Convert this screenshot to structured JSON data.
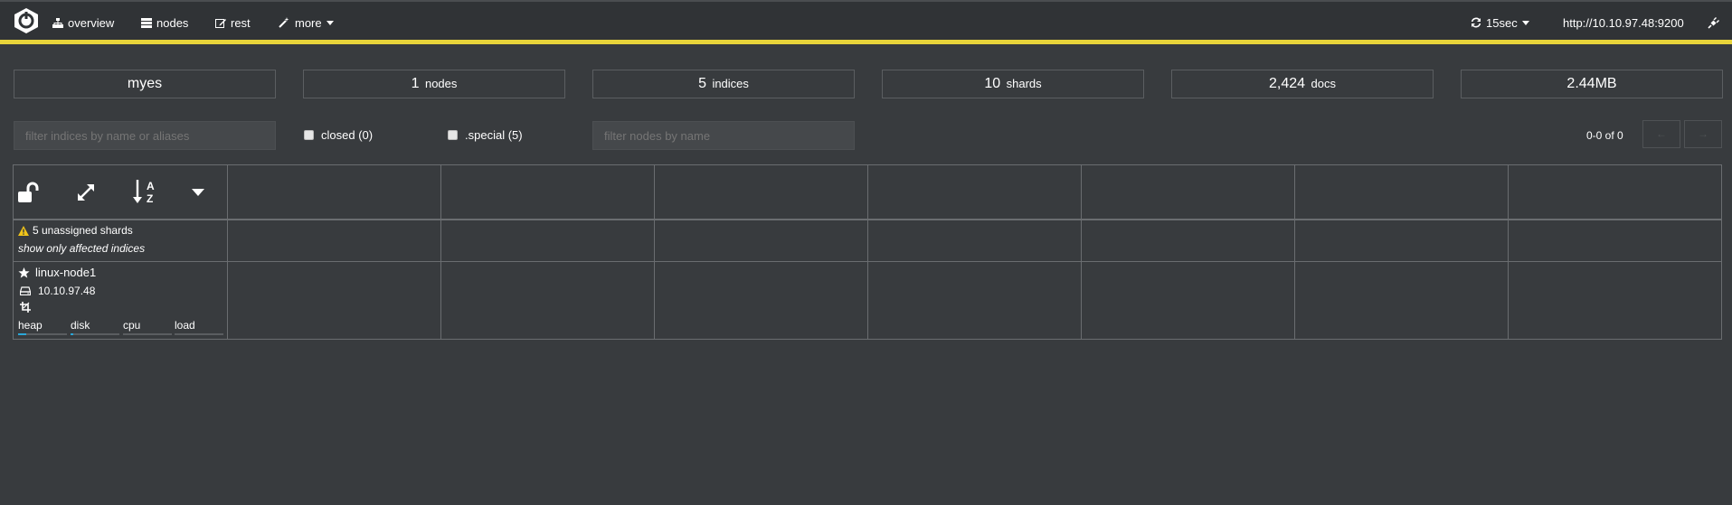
{
  "nav": {
    "items": [
      {
        "label": "overview",
        "icon": "sitemap-icon"
      },
      {
        "label": "nodes",
        "icon": "server-icon"
      },
      {
        "label": "rest",
        "icon": "edit-icon"
      },
      {
        "label": "more",
        "icon": "magic-wand-icon"
      }
    ],
    "refresh_label": "15sec",
    "host_url": "http://10.10.97.48:9200"
  },
  "stats": {
    "cluster_name": "myes",
    "nodes_count": "1",
    "nodes_unit": "nodes",
    "indices_count": "5",
    "indices_unit": "indices",
    "shards_count": "10",
    "shards_unit": "shards",
    "docs_count": "2,424",
    "docs_unit": "docs",
    "size": "2.44MB"
  },
  "filters": {
    "indices_placeholder": "filter indices by name or aliases",
    "closed_label": "closed (0)",
    "special_label": ".special (5)",
    "nodes_placeholder": "filter nodes by name"
  },
  "pager": {
    "text": "0-0 of 0",
    "prev": "←",
    "next": "→"
  },
  "unassigned": {
    "label": "5 unassigned shards",
    "affected_label": "show only affected indices"
  },
  "node": {
    "name": "linux-node1",
    "ip": "10.10.97.48",
    "metrics": [
      {
        "label": "heap",
        "fill": 0.16
      },
      {
        "label": "disk",
        "fill": 0.05
      },
      {
        "label": "cpu",
        "fill": 0
      },
      {
        "label": "load",
        "fill": 0
      }
    ]
  },
  "colors": {
    "accent_bar": "#e8d43a",
    "metric_fill": "#2aa7d8",
    "warning": "#f0c419"
  }
}
